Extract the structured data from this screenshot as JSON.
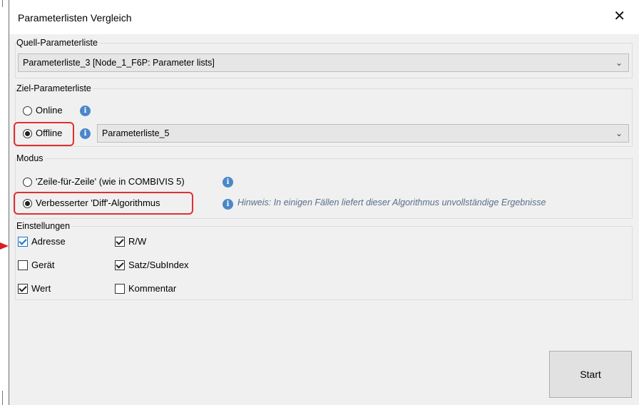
{
  "dialog": {
    "title": "Parameterlisten Vergleich",
    "close": "✕"
  },
  "source": {
    "label": "Quell-Parameterliste",
    "selected": "Parameterliste_3 [Node_1_F6P: Parameter lists]"
  },
  "target": {
    "label": "Ziel-Parameterliste",
    "online_label": "Online",
    "offline_label": "Offline",
    "selected_option": "Offline",
    "offline_selected": "Parameterliste_5"
  },
  "mode": {
    "label": "Modus",
    "line_by_line_label": "'Zeile-für-Zeile' (wie in COMBIVIS 5)",
    "diff_label": "Verbesserter 'Diff'-Algorithmus",
    "selected_option": "Verbesserter 'Diff'-Algorithmus",
    "hint": "Hinweis: In einigen Fällen liefert dieser Algorithmus unvollständige Ergebnisse"
  },
  "settings": {
    "label": "Einstellungen",
    "options": [
      {
        "label": "Adresse",
        "checked": true
      },
      {
        "label": "Gerät",
        "checked": false
      },
      {
        "label": "Wert",
        "checked": true
      },
      {
        "label": "R/W",
        "checked": true
      },
      {
        "label": "Satz/SubIndex",
        "checked": true
      },
      {
        "label": "Kommentar",
        "checked": false
      }
    ]
  },
  "actions": {
    "start_label": "Start"
  },
  "colors": {
    "highlight": "#e03030",
    "info": "#4a88c9",
    "accent": "#1a6fc9"
  },
  "icons": {
    "info": "info-icon",
    "chevron": "chevron-down-icon",
    "close": "close-icon",
    "annotation": "red-arrow-icon"
  }
}
